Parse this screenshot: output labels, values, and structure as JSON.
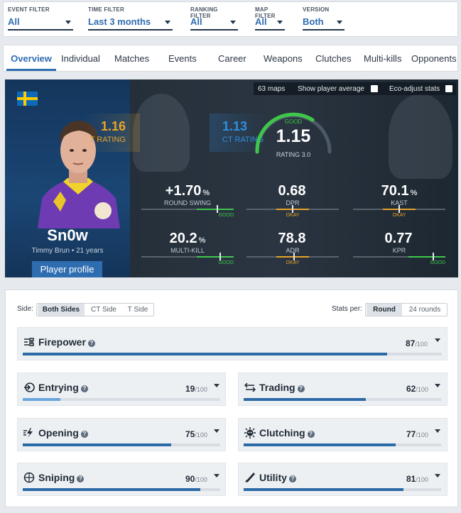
{
  "filters": [
    {
      "label": "EVENT FILTER",
      "value": "All"
    },
    {
      "label": "TIME FILTER",
      "value": "Last 3 months"
    },
    {
      "label": "RANKING FILTER",
      "value": "All"
    },
    {
      "label": "MAP FILTER",
      "value": "All"
    },
    {
      "label": "VERSION",
      "value": "Both"
    }
  ],
  "tabs": [
    "Overview",
    "Individual",
    "Matches",
    "Events",
    "Career",
    "Weapons",
    "Clutches",
    "Multi-kills",
    "Opponents"
  ],
  "active_tab": "Overview",
  "player": {
    "nickname": "Sn0w",
    "realname_age": "Timmy Brun • 21 years",
    "profile_button": "Player profile",
    "country_flag": "sweden-flag-icon"
  },
  "options": {
    "maps_count": "63 maps",
    "show_avg_label": "Show player average",
    "eco_adjust_label": "Eco-adjust stats"
  },
  "ratings": {
    "t_value": "1.16",
    "t_label": "T RATING",
    "main_value": "1.15",
    "main_label": "RATING 3.0",
    "main_grade": "GOOD",
    "ct_value": "1.13",
    "ct_label": "CT RATING"
  },
  "stats": [
    {
      "value": "+1.70",
      "unit": "%",
      "label": "ROUND SWING",
      "grade": "GOOD"
    },
    {
      "value": "0.68",
      "unit": "",
      "label": "DPR",
      "grade": "OKAY"
    },
    {
      "value": "70.1",
      "unit": "%",
      "label": "KAST",
      "grade": "OKAY"
    },
    {
      "value": "20.2",
      "unit": "%",
      "label": "MULTI-KILL",
      "grade": "GOOD"
    },
    {
      "value": "78.8",
      "unit": "",
      "label": "ADR",
      "grade": "OKAY"
    },
    {
      "value": "0.77",
      "unit": "",
      "label": "KPR",
      "grade": "GOOD"
    }
  ],
  "controls": {
    "side_label": "Side:",
    "side_options": [
      "Both Sides",
      "CT Side",
      "T Side"
    ],
    "side_selected": "Both Sides",
    "stats_per_label": "Stats per:",
    "stats_per_options": [
      "Round",
      "24 rounds"
    ],
    "stats_per_selected": "Round"
  },
  "categories": [
    {
      "name": "Firepower",
      "score": "87",
      "of": "/100",
      "fraction": 0.87,
      "icon": "firepower-icon"
    },
    {
      "name": "Entrying",
      "score": "19",
      "of": "/100",
      "fraction": 0.19,
      "icon": "entrying-icon"
    },
    {
      "name": "Trading",
      "score": "62",
      "of": "/100",
      "fraction": 0.62,
      "icon": "trading-icon"
    },
    {
      "name": "Opening",
      "score": "75",
      "of": "/100",
      "fraction": 0.75,
      "icon": "opening-icon"
    },
    {
      "name": "Clutching",
      "score": "77",
      "of": "/100",
      "fraction": 0.77,
      "icon": "clutching-icon"
    },
    {
      "name": "Sniping",
      "score": "90",
      "of": "/100",
      "fraction": 0.9,
      "icon": "sniping-icon"
    },
    {
      "name": "Utility",
      "score": "81",
      "of": "/100",
      "fraction": 0.81,
      "icon": "utility-icon"
    }
  ],
  "colors": {
    "accent": "#2f6db1",
    "good": "#3ec74a",
    "okay": "#e7a429",
    "ct": "#2f8fe1",
    "bar_strong": "#2b6aa6",
    "bar_weak": "#6aa5dd"
  }
}
